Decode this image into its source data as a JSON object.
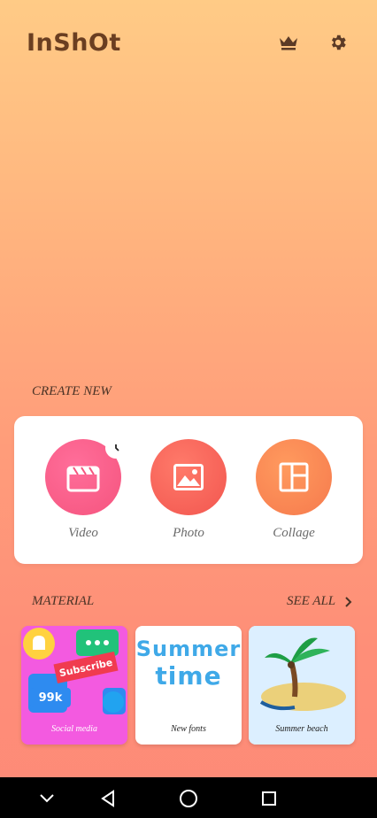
{
  "header": {
    "logo": "InShOt",
    "icons": [
      "crown-icon",
      "gear-icon"
    ]
  },
  "create_new": {
    "title": "CREATE NEW",
    "items": [
      {
        "label": "Video",
        "icon": "video-clapper-icon",
        "color": "#F5547E"
      },
      {
        "label": "Photo",
        "icon": "image-icon",
        "color": "#F2564F"
      },
      {
        "label": "Collage",
        "icon": "collage-layout-icon",
        "color": "#F67A4D"
      }
    ]
  },
  "material": {
    "title": "MATERIAL",
    "see_all": "SEE ALL",
    "items": [
      {
        "label": "Social media",
        "badge": "Subscribe",
        "count": "99k"
      },
      {
        "label": "New fonts",
        "art_line1": "Summer",
        "art_line2": "time"
      },
      {
        "label": "Summer beach"
      }
    ]
  },
  "navbar": {
    "icons": [
      "chevron-down-icon",
      "back-triangle-icon",
      "home-circle-icon",
      "recents-square-icon"
    ]
  },
  "colors": {
    "bg_top": "#FFCB86",
    "bg_bottom": "#FD8A77",
    "logo": "#6A3E21",
    "text": "#4A3326"
  }
}
